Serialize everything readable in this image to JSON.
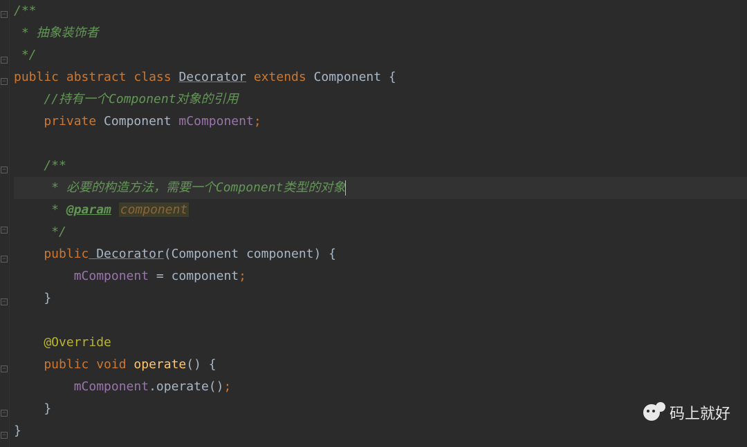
{
  "code": {
    "l1": "/**",
    "l2": " * 抽象装饰者",
    "l3": " */",
    "l4_public": "public",
    "l4_abstract": "abstract",
    "l4_class": "class",
    "l4_name": "Decorator",
    "l4_extends": "extends",
    "l4_parent": "Component",
    "l4_brace": " {",
    "l5": "    //持有一个Component对象的引用",
    "l6_private": "    private",
    "l6_type": " Component",
    "l6_field": " mComponent",
    "l6_semi": ";",
    "l8": "    /**",
    "l9": "     * 必要的构造方法，需要一个Component类型的对象",
    "l10_pre": "     * ",
    "l10_tag": "@param",
    "l10_name": "component",
    "l11": "     */",
    "l12_public": "    public",
    "l12_name": " Decorator",
    "l12_sig": "(Component component) {",
    "l13_field": "        mComponent",
    "l13_rest": " = component",
    "l13_semi": ";",
    "l14": "    }",
    "l16_anno": "    @Override",
    "l17_public": "    public",
    "l17_void": " void",
    "l17_method": " operate",
    "l17_sig": "() {",
    "l18_field": "        mComponent",
    "l18_dot": ".",
    "l18_call": "operate",
    "l18_paren": "()",
    "l18_semi": ";",
    "l19": "    }",
    "l20": "}"
  },
  "folds": [
    16,
    80,
    112,
    240,
    272,
    336,
    368,
    432,
    464,
    528,
    592,
    630
  ],
  "watermark": {
    "text": "码上就好"
  }
}
